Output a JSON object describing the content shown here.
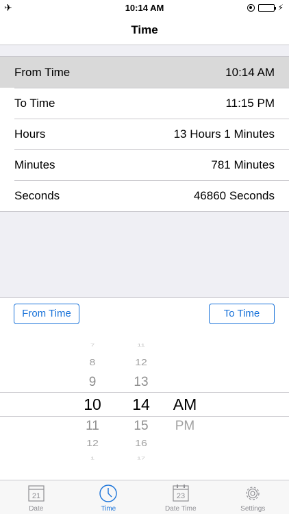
{
  "status_bar": {
    "airplane_icon": "airplane-icon",
    "time": "10:14 AM"
  },
  "nav": {
    "title": "Time"
  },
  "rows": [
    {
      "label": "From Time",
      "value": "10:14 AM"
    },
    {
      "label": "To Time",
      "value": "11:15 PM"
    },
    {
      "label": "Hours",
      "value": "13 Hours 1 Minutes"
    },
    {
      "label": "Minutes",
      "value": "781 Minutes"
    },
    {
      "label": "Seconds",
      "value": "46860 Seconds"
    }
  ],
  "buttons": {
    "from": "From Time",
    "to": "To Time"
  },
  "picker": {
    "hours": [
      "7",
      "8",
      "9",
      "10",
      "11",
      "12",
      "1"
    ],
    "minutes": [
      "11",
      "12",
      "13",
      "14",
      "15",
      "16",
      "17"
    ],
    "ampm": [
      "AM",
      "PM"
    ]
  },
  "tabs": [
    {
      "label": "Date",
      "icon": "calendar-icon",
      "day": "21"
    },
    {
      "label": "Time",
      "icon": "clock-icon"
    },
    {
      "label": "Date Time",
      "icon": "calendar-datetime-icon",
      "day": "23"
    },
    {
      "label": "Settings",
      "icon": "gear-icon"
    }
  ],
  "colors": {
    "accent": "#1a73d9",
    "battery": "#4cd964",
    "selected_row": "#d9d9d9"
  }
}
